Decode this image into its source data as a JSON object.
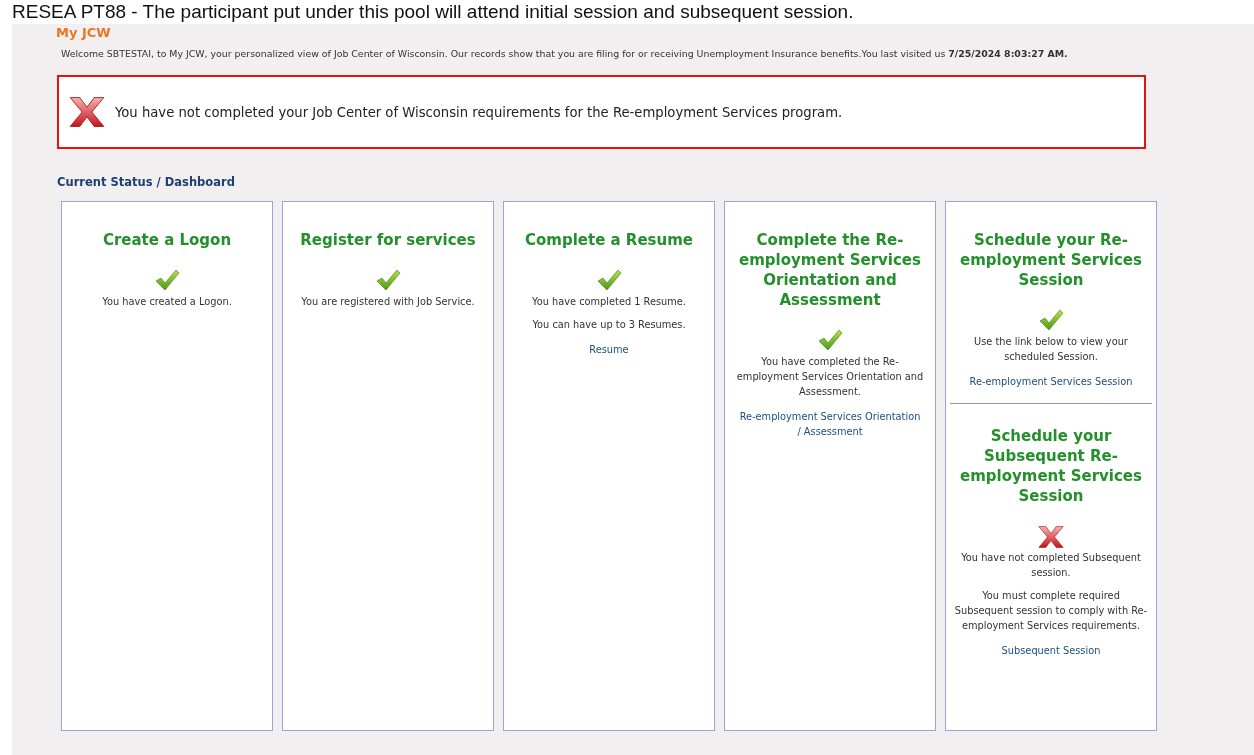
{
  "caption": "RESEA PT88 - The participant put under this pool will attend initial session and subsequent session.",
  "page_title": "My JCW",
  "welcome": "Welcome SBTESTAI, to My JCW, your personalized view of Job Center of Wisconsin. Our records show that you are filing for or receiving Unemployment Insurance benefits.You last visited us **7/25/2024 8:03:27 AM.**",
  "alert": {
    "completed": false,
    "message": "You have not completed your Job Center of Wisconsin requirements for the Re-employment Services program."
  },
  "section_title": "Current Status / Dashboard",
  "cards": [
    {
      "sections": [
        {
          "title": "Create a Logon",
          "completed": true,
          "paragraphs": [
            "You have created a Logon."
          ]
        }
      ]
    },
    {
      "sections": [
        {
          "title": "Register for services",
          "completed": true,
          "paragraphs": [
            "You are registered with Job Service."
          ]
        }
      ]
    },
    {
      "sections": [
        {
          "title": "Complete a Resume",
          "completed": true,
          "paragraphs": [
            "You have completed 1 Resume.",
            "You can have up to 3 Resumes."
          ],
          "links": [
            "Resume"
          ]
        }
      ]
    },
    {
      "sections": [
        {
          "title": "Complete the Re-employment Services Orientation and Assessment",
          "completed": true,
          "paragraphs": [
            "You have completed the Re-employment Services Orientation and Assessment."
          ],
          "links": [
            "Re-employment Services Orientation / Assessment"
          ]
        }
      ]
    },
    {
      "sections": [
        {
          "title": "Schedule your Re-employment Services Session",
          "completed": true,
          "paragraphs": [
            "Use the link below to view your scheduled Session."
          ],
          "links": [
            "Re-employment Services Session"
          ]
        },
        {
          "title": "Schedule your Subsequent Re-employment Services Session",
          "completed": false,
          "paragraphs": [
            "You have not completed Subsequent session.",
            "You must complete required Subsequent session to comply with Re-employment Services requirements."
          ],
          "links": [
            "Subsequent Session"
          ]
        }
      ]
    }
  ]
}
